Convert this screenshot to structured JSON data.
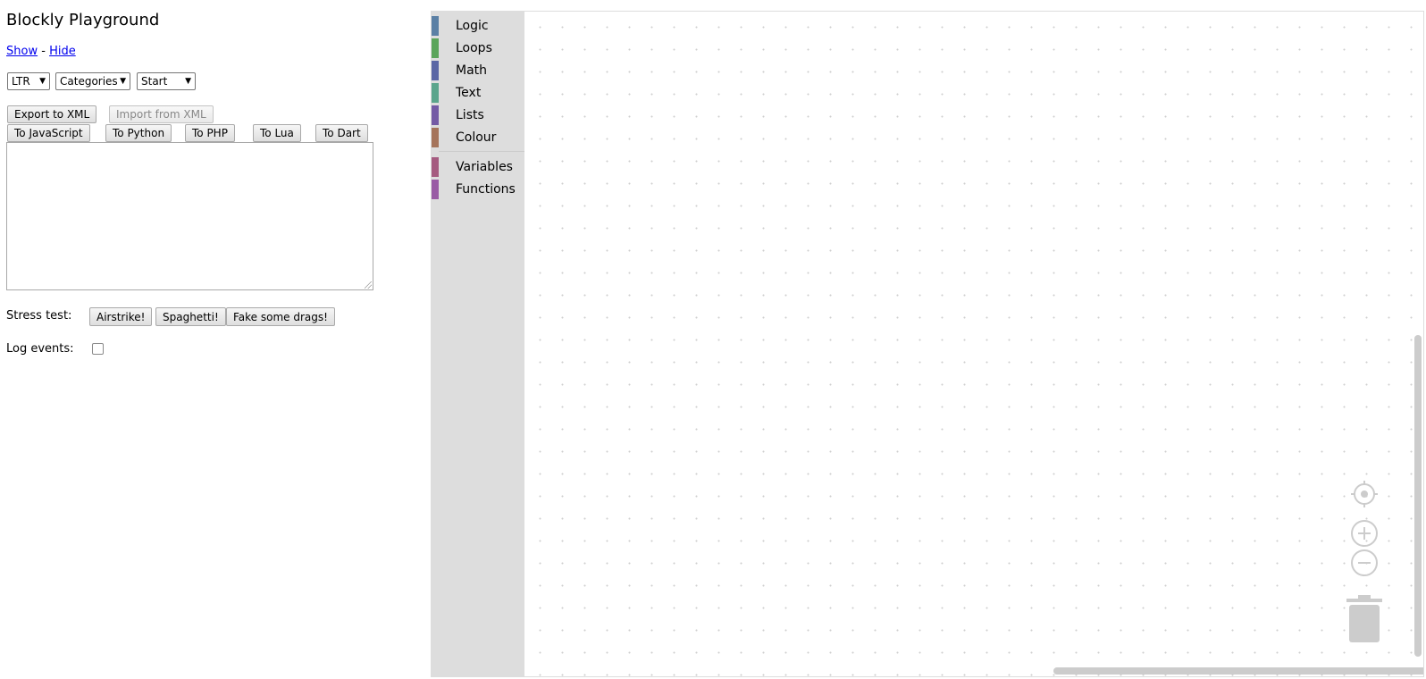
{
  "page": {
    "title": "Blockly Playground",
    "show_label": "Show",
    "separator": "-",
    "hide_label": "Hide"
  },
  "selects": {
    "direction": "LTR",
    "toolbox": "Categories",
    "start": "Start"
  },
  "buttons": {
    "export_xml": "Export to XML",
    "import_xml": "Import from XML",
    "to_javascript": "To JavaScript",
    "to_python": "To Python",
    "to_php": "To PHP",
    "to_lua": "To Lua",
    "to_dart": "To Dart"
  },
  "code_area": {
    "value": ""
  },
  "stress": {
    "label": "Stress test:",
    "airstrike": "Airstrike!",
    "spaghetti": "Spaghetti!",
    "fake_drags": "Fake some drags!"
  },
  "log_events": {
    "label": "Log events:",
    "checked": false
  },
  "toolbox": {
    "categories": [
      {
        "label": "Logic",
        "color": "#5b80a5"
      },
      {
        "label": "Loops",
        "color": "#5ba55b"
      },
      {
        "label": "Math",
        "color": "#5b67a5"
      },
      {
        "label": "Text",
        "color": "#5ba58c"
      },
      {
        "label": "Lists",
        "color": "#745ba5"
      },
      {
        "label": "Colour",
        "color": "#a5745b"
      },
      {
        "label": "Variables",
        "color": "#a55b80"
      },
      {
        "label": "Functions",
        "color": "#995ba5"
      }
    ]
  },
  "workspace_controls": {
    "recenter": "target-icon",
    "zoom_in": "plus-icon",
    "zoom_out": "minus-icon",
    "trash": "trash-icon"
  }
}
